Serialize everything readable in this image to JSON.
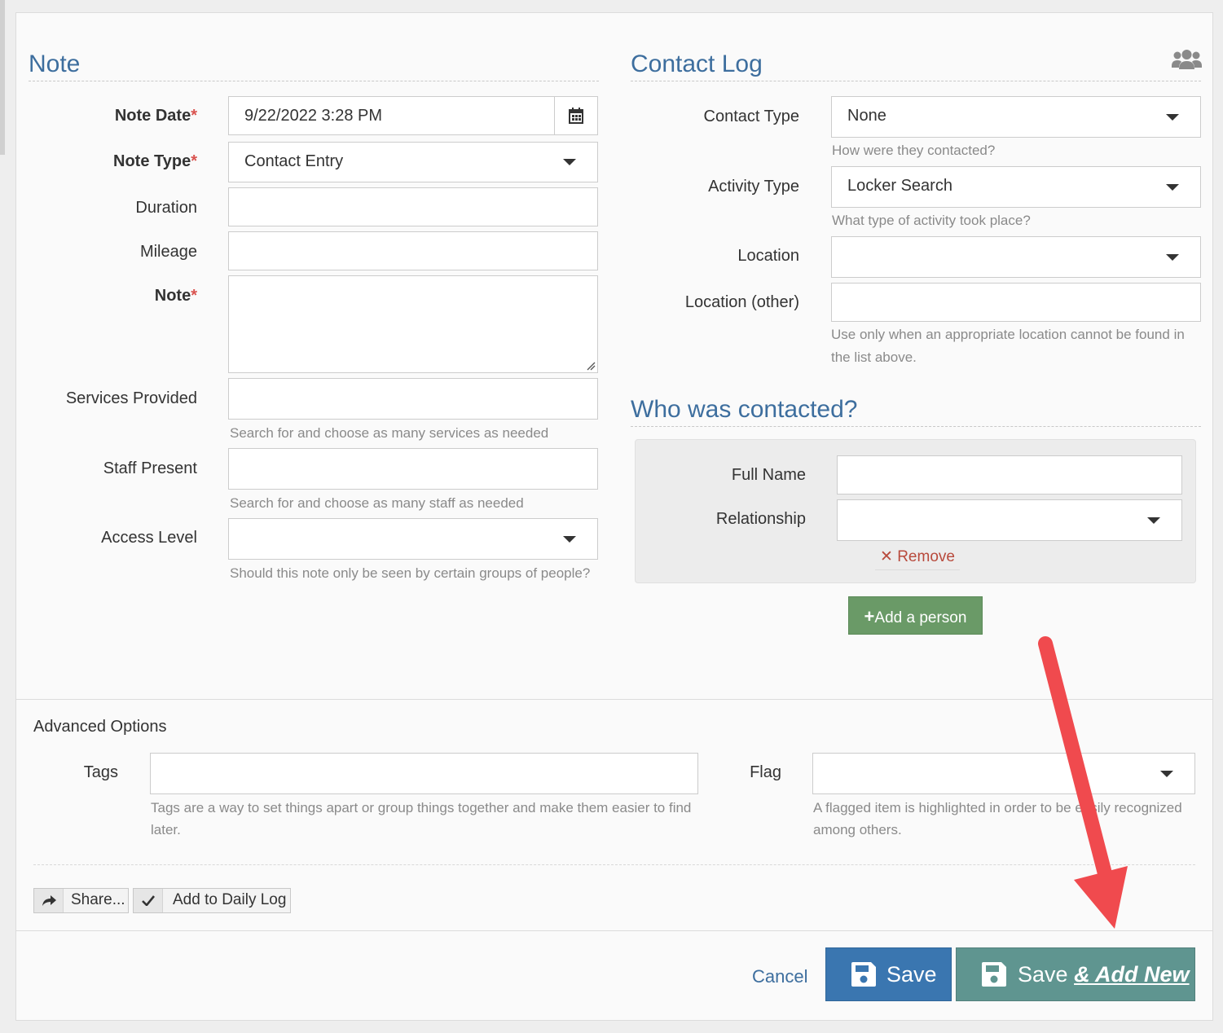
{
  "note_section": {
    "title": "Note",
    "note_date": {
      "label": "Note Date",
      "required": "*",
      "value": "9/22/2022 3:28 PM"
    },
    "note_type": {
      "label": "Note Type",
      "required": "*",
      "value": "Contact Entry"
    },
    "duration": {
      "label": "Duration",
      "value": ""
    },
    "mileage": {
      "label": "Mileage",
      "value": ""
    },
    "note": {
      "label": "Note",
      "required": "*",
      "value": ""
    },
    "services_provided": {
      "label": "Services Provided",
      "value": "",
      "help": "Search for and choose as many services as needed"
    },
    "staff_present": {
      "label": "Staff Present",
      "value": "",
      "help": "Search for and choose as many staff as needed"
    },
    "access_level": {
      "label": "Access Level",
      "value": "",
      "help": "Should this note only be seen by certain groups of people?"
    }
  },
  "contact_log": {
    "title": "Contact Log",
    "header_icon": "users-icon",
    "contact_type": {
      "label": "Contact Type",
      "value": "None",
      "help": "How were they contacted?"
    },
    "activity_type": {
      "label": "Activity Type",
      "value": "Locker Search",
      "help": "What type of activity took place?"
    },
    "location": {
      "label": "Location",
      "value": ""
    },
    "location_other": {
      "label": "Location (other)",
      "value": "",
      "help": "Use only when an appropriate location cannot be found in the list above."
    }
  },
  "who_contacted": {
    "title": "Who was contacted?",
    "full_name": {
      "label": "Full Name",
      "value": ""
    },
    "relationship": {
      "label": "Relationship",
      "value": ""
    },
    "remove_label": "Remove",
    "add_person_label": "Add a person",
    "add_color": "#6a9a67"
  },
  "advanced": {
    "title": "Advanced Options",
    "tags": {
      "label": "Tags",
      "value": "",
      "help": "Tags are a way to set things apart or group things together and make them easier to find later."
    },
    "flag": {
      "label": "Flag",
      "value": "",
      "help": "A flagged item is highlighted in order to be easily recognized among others."
    },
    "share_label": "Share...",
    "daily_log_label": "Add to Daily Log"
  },
  "footer": {
    "cancel_label": "Cancel",
    "save_label": "Save",
    "save_add_prefix": "Save",
    "save_add_emph": "& Add New",
    "save_color": "#3a76b0",
    "save_add_color": "#5f9590"
  },
  "annotation": {
    "arrow_color": "#f04a4e"
  }
}
